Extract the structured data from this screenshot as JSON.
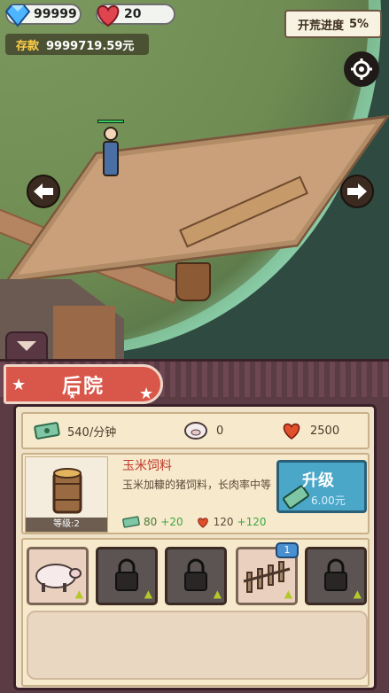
{
  "hud": {
    "gems": "99999",
    "hearts": "20",
    "progress_label": "开荒进度",
    "progress_value": "5%",
    "savings_label": "存款",
    "savings_value": "9999719.59元"
  },
  "panel": {
    "title": "后院",
    "stats": {
      "income": "540/分钟",
      "pigs": "0",
      "hearts": "2500"
    },
    "item": {
      "name": "玉米饲料",
      "description": "玉米加糠的猪饲料，长肉率中等",
      "level": "等级:2",
      "cost_money": "80",
      "cost_money_plus": "+20",
      "cost_heart": "120",
      "cost_heart_plus": "+120",
      "upgrade_label": "升级",
      "upgrade_price": "6.00元"
    },
    "slots": [
      {
        "name": "pig",
        "state": "light"
      },
      {
        "name": "locked",
        "state": "dark"
      },
      {
        "name": "locked",
        "state": "dark"
      },
      {
        "name": "fence",
        "state": "light",
        "badge": "1"
      },
      {
        "name": "locked",
        "state": "dark"
      }
    ]
  },
  "colors": {
    "banner": "#d9574a",
    "panel": "#5b3b44",
    "upgrade": "#4aa7c7",
    "accent_gold": "#ffd04a"
  }
}
